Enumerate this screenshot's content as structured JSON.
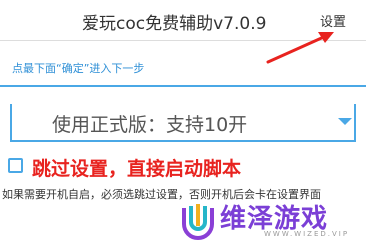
{
  "titlebar": {
    "title": "爱玩coc免费辅助v7.0.9",
    "settings_label": "设置"
  },
  "hint": {
    "text": "点最下面“确定”进入下一步"
  },
  "mode_select": {
    "selected": "使用正式版：支持10开"
  },
  "skip_settings": {
    "checked": false,
    "label": "跳过设置，直接启动脚本"
  },
  "note": {
    "text": "如果需要开机自启，必须选跳过设置，否则开机后会卡在设置界面"
  },
  "watermark": {
    "text": "维泽游戏",
    "sub": "WWW.WIZED.VIP"
  },
  "colors": {
    "accent": "#4aa8e6",
    "hint": "#2e8fd6",
    "warning": "#e8231f",
    "arrow": "#e8231f",
    "watermark": "#7b3fd6"
  }
}
